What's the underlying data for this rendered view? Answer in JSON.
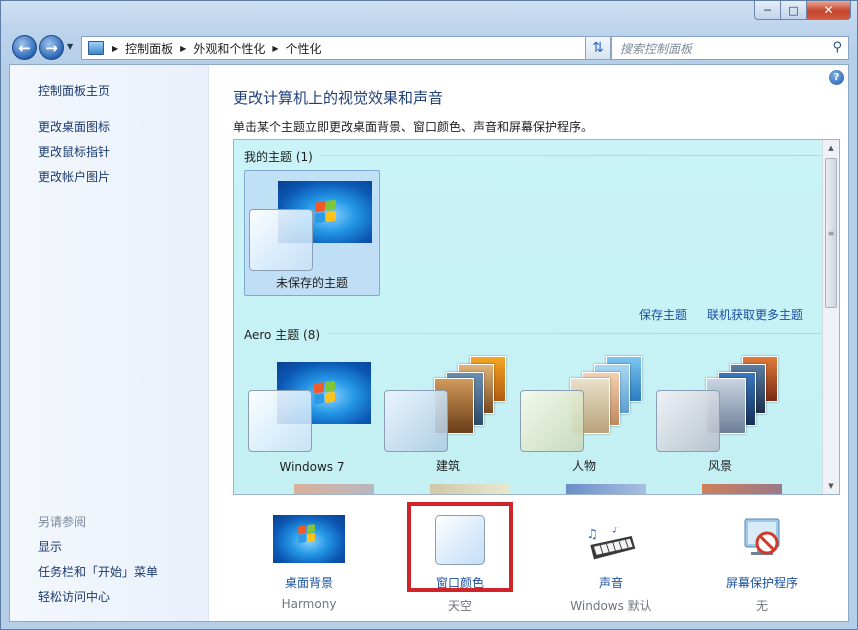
{
  "nav": {
    "breadcrumbs": [
      "控制面板",
      "外观和个性化",
      "个性化"
    ],
    "search_placeholder": "搜索控制面板"
  },
  "sidebar": {
    "links": [
      "控制面板主页",
      "更改桌面图标",
      "更改鼠标指针",
      "更改帐户图片"
    ],
    "see_also_title": "另请参阅",
    "see_also": [
      "显示",
      "任务栏和「开始」菜单",
      "轻松访问中心"
    ]
  },
  "main": {
    "title": "更改计算机上的视觉效果和声音",
    "description": "单击某个主题立即更改桌面背景、窗口颜色、声音和屏幕保护程序。",
    "my_themes_label": "我的主题 (1)",
    "unsaved_theme": "未保存的主题",
    "save_theme_link": "保存主题",
    "get_more_link": "联机获取更多主题",
    "aero_label": "Aero 主题 (8)",
    "aero_themes": [
      "Windows 7",
      "建筑",
      "人物",
      "风景"
    ]
  },
  "bottom": [
    {
      "label": "桌面背景",
      "sub": "Harmony"
    },
    {
      "label": "窗口颜色",
      "sub": "天空"
    },
    {
      "label": "声音",
      "sub": "Windows 默认"
    },
    {
      "label": "屏幕保护程序",
      "sub": "无"
    }
  ],
  "colors": {
    "link": "#1a4fa0",
    "panel_bg": "#c9f3f7",
    "highlight": "#d1242a"
  }
}
